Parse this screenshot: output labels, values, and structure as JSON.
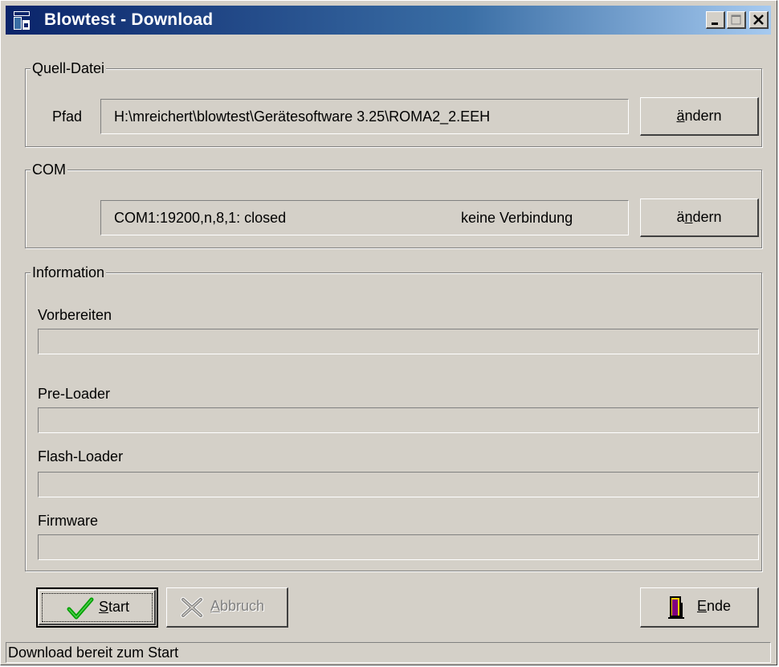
{
  "window": {
    "title": "Blowtest - Download",
    "controls": [
      "minimize-icon",
      "maximize-icon",
      "close-icon"
    ]
  },
  "source": {
    "group_label": "Quell-Datei",
    "path_label": "Pfad",
    "path_value": "H:\\mreichert\\blowtest\\Gerätesoftware 3.25\\ROMA2_2.EEH",
    "change_button": {
      "before": "",
      "mnemonic": "ä",
      "after": "ndern"
    }
  },
  "com": {
    "group_label": "COM",
    "port_status": "COM1:19200,n,8,1: closed",
    "connection_status": "keine Verbindung",
    "change_button": {
      "before": "ä",
      "mnemonic": "n",
      "after": "dern"
    }
  },
  "information": {
    "group_label": "Information",
    "steps": [
      {
        "label": "Vorbereiten",
        "progress": 0
      },
      {
        "label": "Pre-Loader",
        "progress": 0
      },
      {
        "label": "Flash-Loader",
        "progress": 0
      },
      {
        "label": "Firmware",
        "progress": 0
      }
    ]
  },
  "buttons": {
    "start": {
      "mnemonic": "S",
      "rest": "tart",
      "icon": "checkmark-icon",
      "enabled": true,
      "default": true
    },
    "abort": {
      "mnemonic": "A",
      "rest": "bbruch",
      "icon": "cross-icon",
      "enabled": false
    },
    "end": {
      "mnemonic": "E",
      "rest": "nde",
      "icon": "exit-door-icon",
      "enabled": true
    }
  },
  "status_bar": {
    "text": "Download bereit zum Start"
  },
  "colors": {
    "face": "#d4d0c8",
    "title_start": "#0a246a",
    "title_end": "#a6caf0",
    "check_green": "#00a000"
  }
}
